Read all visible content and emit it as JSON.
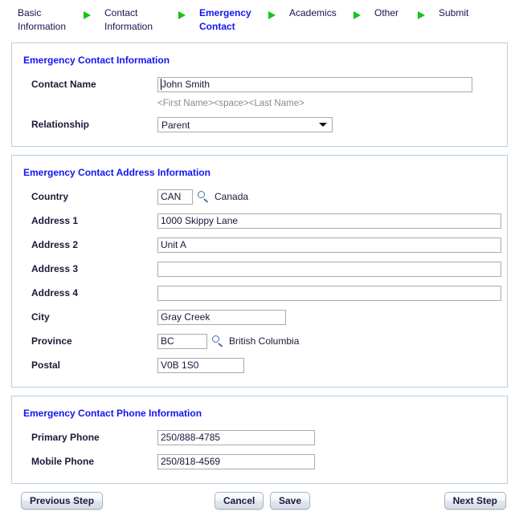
{
  "nav": {
    "steps": [
      {
        "label": "Basic\nInformation",
        "active": false
      },
      {
        "label": "Contact\nInformation",
        "active": false
      },
      {
        "label": "Emergency\nContact",
        "active": true
      },
      {
        "label": "Academics",
        "active": false
      },
      {
        "label": "Other",
        "active": false
      },
      {
        "label": "Submit",
        "active": false
      }
    ],
    "separator_icon": "globe-play-icon",
    "active_color": "#1414ee",
    "inactive_color": "#16164a"
  },
  "contact_section": {
    "title": "Emergency Contact Information",
    "contact_name_label": "Contact Name",
    "contact_name_value": "John Smith",
    "contact_name_hint": "<First Name><space><Last Name>",
    "relationship_label": "Relationship",
    "relationship_value": "Parent",
    "relationship_options": [
      "Parent"
    ]
  },
  "address_section": {
    "title": "Emergency Contact Address Information",
    "country_label": "Country",
    "country_code": "CAN",
    "country_name": "Canada",
    "address1_label": "Address 1",
    "address1_value": "1000 Skippy Lane",
    "address2_label": "Address 2",
    "address2_value": "Unit A",
    "address3_label": "Address 3",
    "address3_value": "",
    "address4_label": "Address 4",
    "address4_value": "",
    "city_label": "City",
    "city_value": "Gray Creek",
    "province_label": "Province",
    "province_code": "BC",
    "province_name": "British Columbia",
    "postal_label": "Postal",
    "postal_value": "V0B 1S0",
    "lookup_icon": "search-icon"
  },
  "phone_section": {
    "title": "Emergency Contact Phone Information",
    "primary_label": "Primary Phone",
    "primary_value": "250/888-4785",
    "mobile_label": "Mobile Phone",
    "mobile_value": "250/818-4569"
  },
  "buttons": {
    "previous": "Previous Step",
    "cancel": "Cancel",
    "save": "Save",
    "next": "Next Step"
  }
}
